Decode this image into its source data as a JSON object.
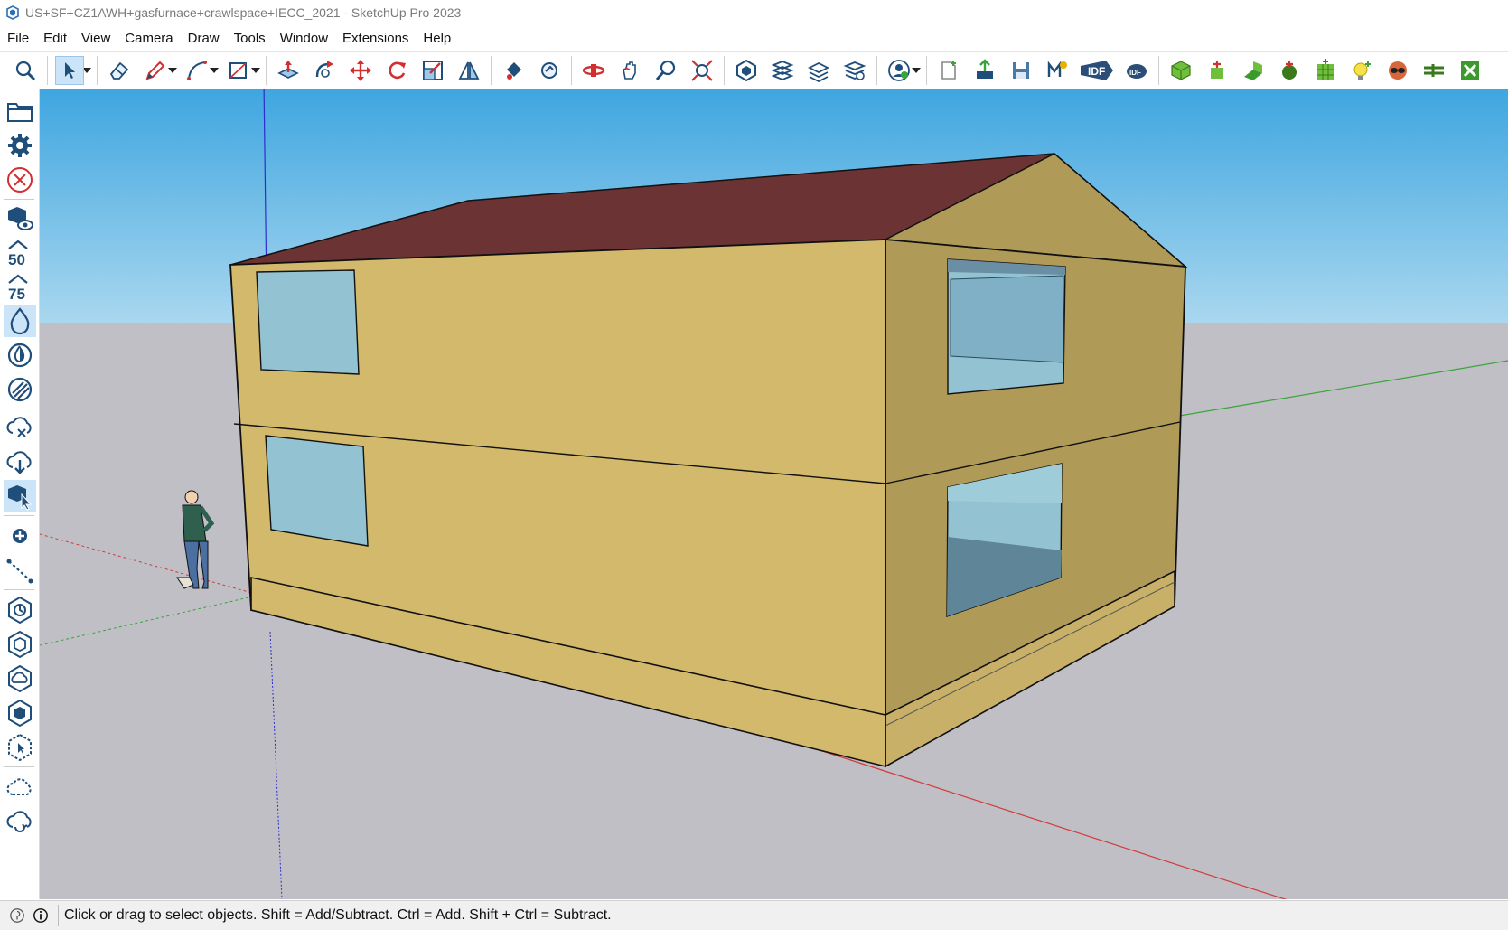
{
  "window": {
    "title": "US+SF+CZ1AWH+gasfurnace+crawlspace+IECC_2021 - SketchUp Pro 2023"
  },
  "menu": {
    "items": [
      "File",
      "Edit",
      "View",
      "Camera",
      "Draw",
      "Tools",
      "Window",
      "Extensions",
      "Help"
    ]
  },
  "toolbar": {
    "icons": [
      "search-icon",
      "select-icon",
      "eraser-icon",
      "pencil-icon",
      "arc-icon",
      "rectangle-icon",
      "push-pull-icon",
      "follow-me-icon",
      "move-icon",
      "rotate-icon",
      "scale-icon",
      "flip-icon",
      "paint-bucket-icon",
      "tape-measure-icon",
      "orbit-icon",
      "pan-icon",
      "zoom-icon",
      "zoom-extents-icon",
      "warehouse-icon",
      "layers-icon",
      "sandbox-icon",
      "components-icon",
      "account-icon",
      "idf-new-icon",
      "idf-export-icon",
      "idf-save-icon",
      "idf-import-icon",
      "idf-badge-icon",
      "idf-cloud-icon",
      "openstudio-space-icon",
      "openstudio-zone-icon",
      "openstudio-surface-icon",
      "openstudio-add-icon",
      "openstudio-grid-icon",
      "openstudio-light-icon",
      "openstudio-glasses-icon",
      "openstudio-flow-icon",
      "openstudio-extra-icon"
    ],
    "idf_label": "IDF"
  },
  "sidebar": {
    "icons": [
      "open-folder-icon",
      "settings-gear-icon",
      "close-circle-icon",
      "view-icon",
      "fifty-icon",
      "seventy-five-icon",
      "water-drop-icon",
      "half-drop-icon",
      "hatch-circle-icon",
      "cloud-x-icon",
      "cloud-download-icon",
      "cube-pointer-icon",
      "add-point-icon",
      "dotted-line-icon",
      "history-hex-icon",
      "hex-outline-icon",
      "cloud-hex-icon",
      "cube-hex-icon",
      "select-hex-icon",
      "cloud-outline-icon",
      "cloud-sync-icon"
    ],
    "fifty_label": "50",
    "seventy_five_label": "75"
  },
  "scene": {
    "sky_color": "#58b2e4",
    "ground_color": "#bfbfc5",
    "wall_front_color": "#d3b96c",
    "wall_side_color": "#b09a57",
    "roof_color": "#6b3334",
    "window_color": "#93c3d2",
    "axis_red": "#d23b3b",
    "axis_green": "#3aa43a",
    "axis_blue": "#2d2dd0"
  },
  "status": {
    "message": "Click or drag to select objects. Shift = Add/Subtract. Ctrl = Add. Shift + Ctrl = Subtract."
  }
}
